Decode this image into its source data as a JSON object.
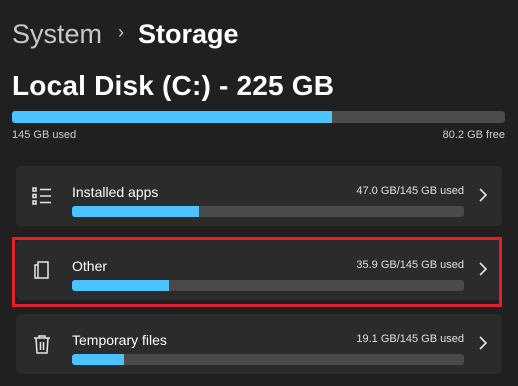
{
  "breadcrumb": {
    "parent": "System",
    "separator": "›",
    "current": "Storage"
  },
  "disk": {
    "title": "Local Disk (C:) - 225 GB",
    "used_label": "145 GB used",
    "free_label": "80.2 GB free",
    "used_fraction": 0.65
  },
  "categories": [
    {
      "label": "Installed apps",
      "usage": "47.0 GB/145 GB used",
      "fraction": 0.324,
      "icon": "list-icon"
    },
    {
      "label": "Other",
      "usage": "35.9 GB/145 GB used",
      "fraction": 0.248,
      "icon": "document-icon",
      "highlighted": true
    },
    {
      "label": "Temporary files",
      "usage": "19.1 GB/145 GB used",
      "fraction": 0.132,
      "icon": "trash-icon"
    }
  ],
  "colors": {
    "accent": "#4cc2ff",
    "highlight": "#e0202a",
    "background": "#202020",
    "card": "#2b2b2b"
  }
}
